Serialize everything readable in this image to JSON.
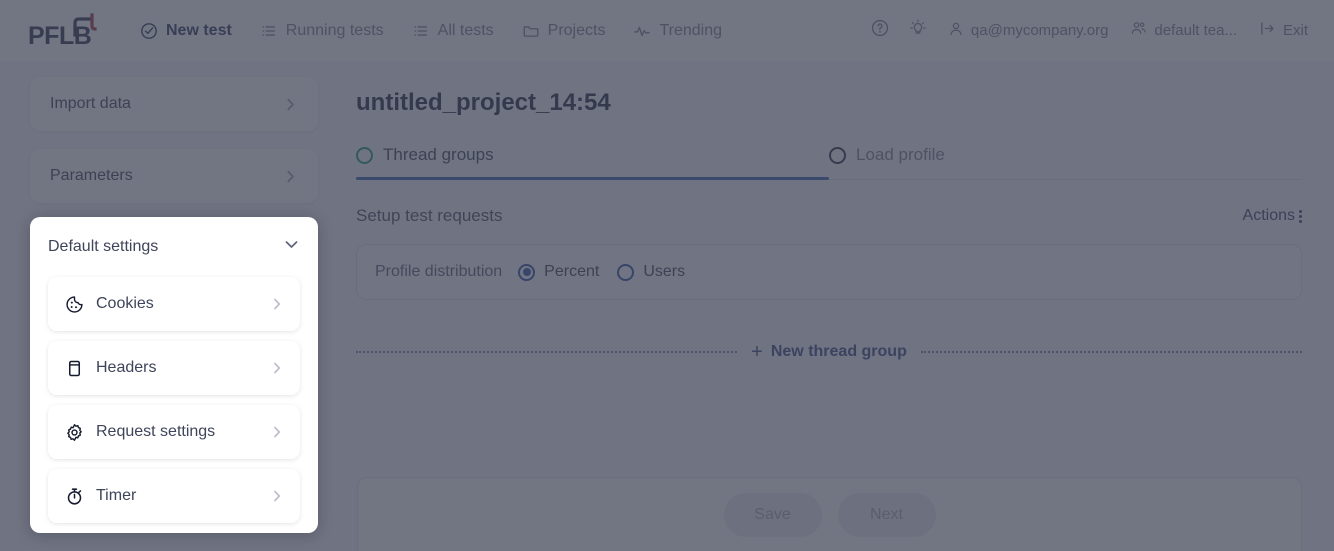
{
  "header": {
    "logo_text": "PFLB",
    "nav": [
      {
        "label": "New test",
        "icon": "check-circle-icon",
        "active": true
      },
      {
        "label": "Running tests",
        "icon": "list-icon",
        "active": false
      },
      {
        "label": "All tests",
        "icon": "list-icon",
        "active": false
      },
      {
        "label": "Projects",
        "icon": "folder-icon",
        "active": false
      },
      {
        "label": "Trending",
        "icon": "pulse-icon",
        "active": false
      }
    ],
    "help_icon": "question-circle-icon",
    "tips_icon": "lightbulb-icon",
    "account": "qa@mycompany.org",
    "team": "default tea...",
    "exit": "Exit"
  },
  "sidebar": {
    "cards": [
      {
        "label": "Import data"
      },
      {
        "label": "Parameters"
      }
    ],
    "panel": {
      "title": "Default settings",
      "expanded": true,
      "items": [
        {
          "label": "Cookies",
          "icon": "cookie-icon"
        },
        {
          "label": "Headers",
          "icon": "document-icon"
        },
        {
          "label": "Request settings",
          "icon": "gear-icon"
        },
        {
          "label": "Timer",
          "icon": "stopwatch-icon"
        }
      ]
    }
  },
  "main": {
    "title": "untitled_project_14:54",
    "tabs": [
      {
        "label": "Thread groups",
        "active": true,
        "marker_color": "#1f9d6b"
      },
      {
        "label": "Load profile",
        "active": false,
        "marker_color": "#2b3149"
      }
    ],
    "section_title": "Setup test requests",
    "actions_label": "Actions",
    "profile_distribution": {
      "label": "Profile distribution",
      "options": [
        {
          "label": "Percent",
          "selected": true
        },
        {
          "label": "Users",
          "selected": false
        }
      ]
    },
    "add_thread_group_label": "New thread group"
  },
  "footer": {
    "save_label": "Save",
    "next_label": "Next"
  },
  "colors": {
    "accent_blue": "#3a62b0",
    "brand_navy": "#2e3551",
    "brand_red": "#a8354a",
    "green_ring": "#1f9d6b",
    "overlay": "rgba(60,64,82,0.72)"
  }
}
